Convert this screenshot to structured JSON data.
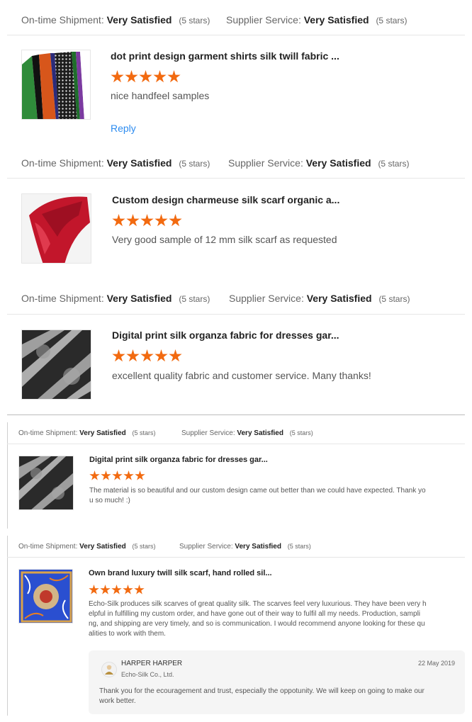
{
  "labels": {
    "ontime": "On-time Shipment:",
    "supplier": "Supplier Service:",
    "very_satisfied": "Very Satisfied",
    "five_stars": "(5 stars)"
  },
  "reviews": [
    {
      "title": "dot print design garment shirts silk twill fabric ...",
      "text": "nice handfeel samples",
      "reply": "Reply",
      "rating": 5
    },
    {
      "title": "Custom design charmeuse silk scarf organic a...",
      "text": "Very good sample of 12 mm silk scarf as requested",
      "rating": 5
    },
    {
      "title": "Digital print silk organza fabric for dresses gar...",
      "text": "excellent quality fabric and customer service. Many thanks!",
      "rating": 5
    },
    {
      "title": "Digital print silk organza fabric for dresses gar...",
      "text_line1": "The material is so beautiful and our custom design came out better than we could have expected. Thank yo",
      "text_line2": "u so much! :)",
      "rating": 5
    },
    {
      "title": "Own brand luxury twill silk scarf, hand rolled sil...",
      "text_line1": "Echo-Silk produces silk scarves of great quality silk. The scarves feel very luxurious. They have been very h",
      "text_line2": "elpful in fulfilling my custom order, and have gone out of their way to fulfil all my needs. Production, sampli",
      "text_line3": "ng, and shipping are very timely, and so is communication. I would recommend anyone looking for these qu",
      "text_line4": "alities to work with them.",
      "rating": 5
    }
  ],
  "supplier_reply": {
    "name": "HARPER HARPER",
    "company": "Echo-Silk Co., Ltd.",
    "date": "22 May 2019",
    "line1": "Thank you for the ecouragement and trust, especially the oppotunity. We will keep on going to make our",
    "line2": "work better."
  },
  "colors": {
    "star": "#f26a10",
    "link": "#2d8cf0"
  }
}
